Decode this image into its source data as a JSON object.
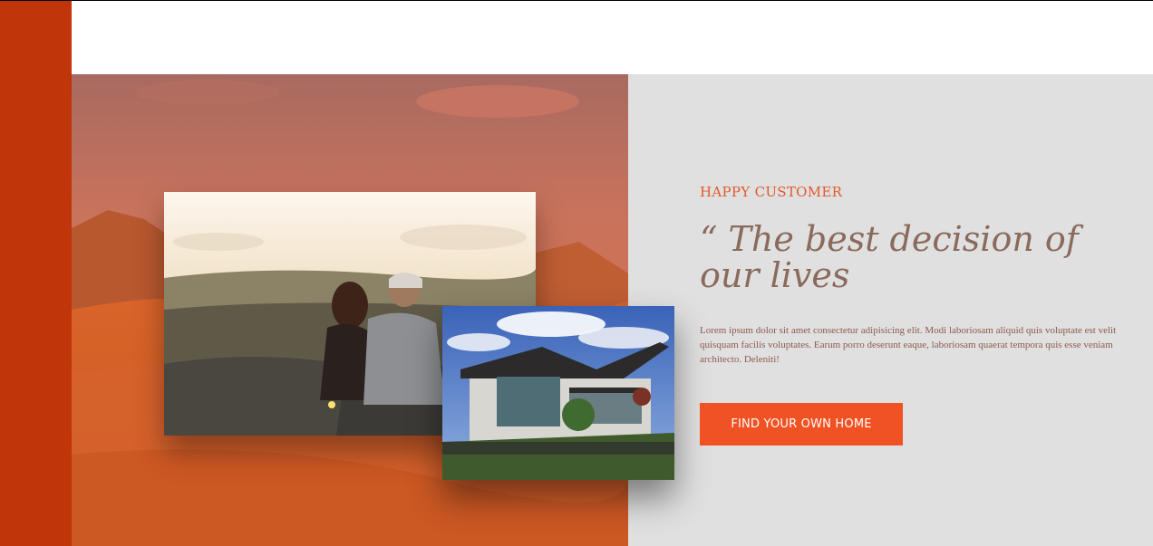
{
  "testimonial": {
    "eyebrow": "HAPPY CUSTOMER",
    "headline": "“ The best decision of our lives",
    "body": "Lorem ipsum dolor sit amet consectetur adipisicing elit. Modi laboriosam aliquid quis voluptate est velit quisquam facilis voluptates. Earum porro deserunt eaque, laboriosam quaerat tempora quis esse veniam architecto. Deleniti!",
    "cta_label": "FIND YOUR OWN HOME"
  },
  "images": {
    "hero": "desert-dunes-photo",
    "couple": "couple-sunset-photo",
    "house": "modern-house-photo"
  },
  "colors": {
    "sidebar": "#c1350b",
    "accent": "#f05223",
    "eyebrow": "#e2582c",
    "headline": "#8a6a5c",
    "panel": "#e0e0e0"
  }
}
